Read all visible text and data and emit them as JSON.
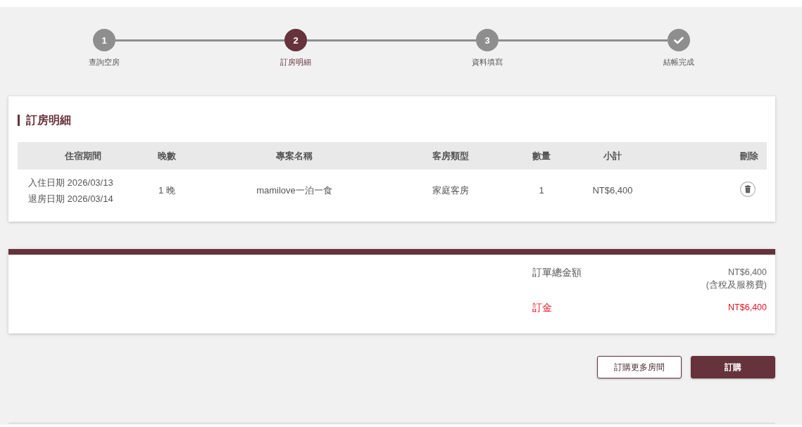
{
  "steps": [
    {
      "kind": "number",
      "number": "1",
      "label": "查詢空房",
      "selected": false
    },
    {
      "kind": "number",
      "number": "2",
      "label": "訂房明細",
      "selected": true
    },
    {
      "kind": "number",
      "number": "3",
      "label": "資料填寫",
      "selected": false
    },
    {
      "kind": "check",
      "label": "結帳完成",
      "selected": false
    }
  ],
  "booking_details": {
    "title": "訂房明細",
    "table": {
      "columns": [
        "住宿期間",
        "晚數",
        "專案名稱",
        "客房類型",
        "數量",
        "小計",
        "刪除"
      ],
      "rows": [
        {
          "check_in": "入住日期 2026/03/13",
          "check_out": "退房日期 2026/03/14",
          "nights": "1 晚",
          "plan": "mamilove一泊一食",
          "room_type": "家庭客房",
          "quantity": "1",
          "subtotal": "NT$6,400"
        }
      ]
    }
  },
  "summary": {
    "lines": [
      {
        "kind": "total",
        "label": "訂單總金額",
        "value": "NT$6,400",
        "note": "(含稅及服務費)"
      },
      {
        "kind": "deposit",
        "label": "訂金",
        "value": "NT$6,400"
      }
    ]
  },
  "buttons": [
    {
      "kind": "secondary",
      "label": "訂購更多房間"
    },
    {
      "kind": "primary",
      "label": "訂購"
    }
  ]
}
